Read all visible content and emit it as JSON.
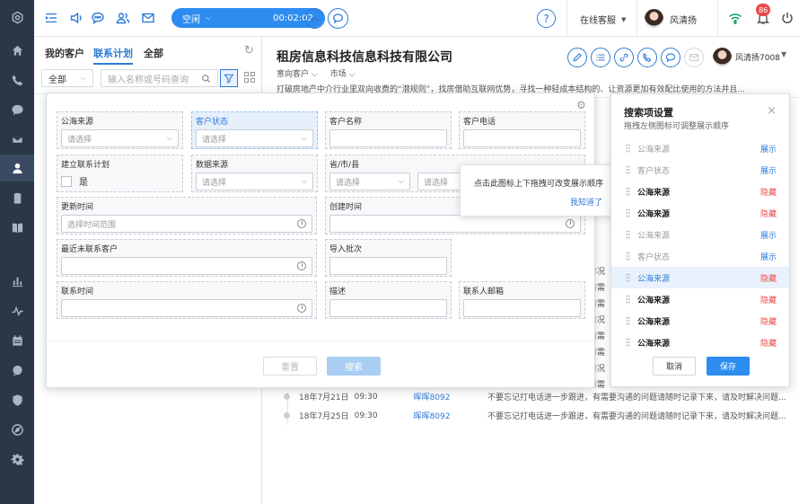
{
  "topbar": {
    "status": "空闲",
    "timer": "00:02:02",
    "service_status": "在线客服",
    "user_name": "风清扬",
    "notification_count": "86"
  },
  "left_panel": {
    "tabs": [
      "我的客户",
      "联系计划",
      "全部"
    ],
    "scope_select": "全部",
    "search_placeholder": "输入名称或号码查询"
  },
  "customer": {
    "name": "租房信息科技信息科技有限公司",
    "intent": "意向客户",
    "channel": "市场",
    "description": "打破房地产中介行业里双向收费的“潜规则”，找房借助互联网优势，寻找一种轻成本结构的、让资源更加有效配比使用的方法并且...",
    "agent": "风清扬7008"
  },
  "timeline": [
    {
      "date": "18年7月21日",
      "time": "09:30",
      "user": "晖晖8092",
      "note": "不要忘记打电话进一步跟进，有需要沟通的问题请随时记录下来，请及时解决问题..."
    },
    {
      "date": "18年7月25日",
      "time": "09:30",
      "user": "晖晖8092",
      "note": "不要忘记打电话进一步跟进，有需要沟通的问题请随时记录下来，请及时解决问题..."
    }
  ],
  "clipped_notes": [
    "青况",
    "有需",
    "有需",
    "青况",
    "有需",
    "有需",
    "青况",
    "有需"
  ],
  "filter": {
    "fields": {
      "pool_source": "公海来源",
      "customer_status": "客户状态",
      "customer_name": "客户名称",
      "customer_phone": "客户电话",
      "create_plan": "建立联系计划",
      "data_source": "数据来源",
      "region": "省/市/县",
      "update_time": "更新时间",
      "create_time": "创建时间",
      "last_contact": "最近未联系客户",
      "import_batch": "导入批次",
      "contact_time": "联系时间",
      "description": "描述",
      "contact_email": "联系人邮箱"
    },
    "select_placeholder": "请选择",
    "time_placeholder": "选择时间范围",
    "yes": "是",
    "reset": "重置",
    "search": "搜索"
  },
  "tooltip": {
    "text": "点击此图标上下拖拽可改变展示顺序",
    "ack": "我知道了"
  },
  "search_settings": {
    "title": "搜索项设置",
    "subtitle": "拖拽左侧图标可调整展示顺序",
    "items": [
      {
        "label": "公海来源",
        "action": "展示",
        "state": "hidden"
      },
      {
        "label": "客户状态",
        "action": "展示",
        "state": "hidden"
      },
      {
        "label": "公海来源",
        "action": "隐藏",
        "state": "shown"
      },
      {
        "label": "公海来源",
        "action": "隐藏",
        "state": "shown"
      },
      {
        "label": "公海来源",
        "action": "展示",
        "state": "hidden"
      },
      {
        "label": "客户状态",
        "action": "展示",
        "state": "hidden"
      },
      {
        "label": "公海来源",
        "action": "隐藏",
        "state": "selected"
      },
      {
        "label": "公海来源",
        "action": "隐藏",
        "state": "shown"
      },
      {
        "label": "公海来源",
        "action": "隐藏",
        "state": "shown"
      },
      {
        "label": "公海来源",
        "action": "隐藏",
        "state": "shown"
      }
    ],
    "cancel": "取消",
    "save": "保存"
  },
  "colors": {
    "primary": "#2d7ad6",
    "sidebar": "#2b3648",
    "danger": "#e94b4b",
    "success": "#19a15f"
  }
}
